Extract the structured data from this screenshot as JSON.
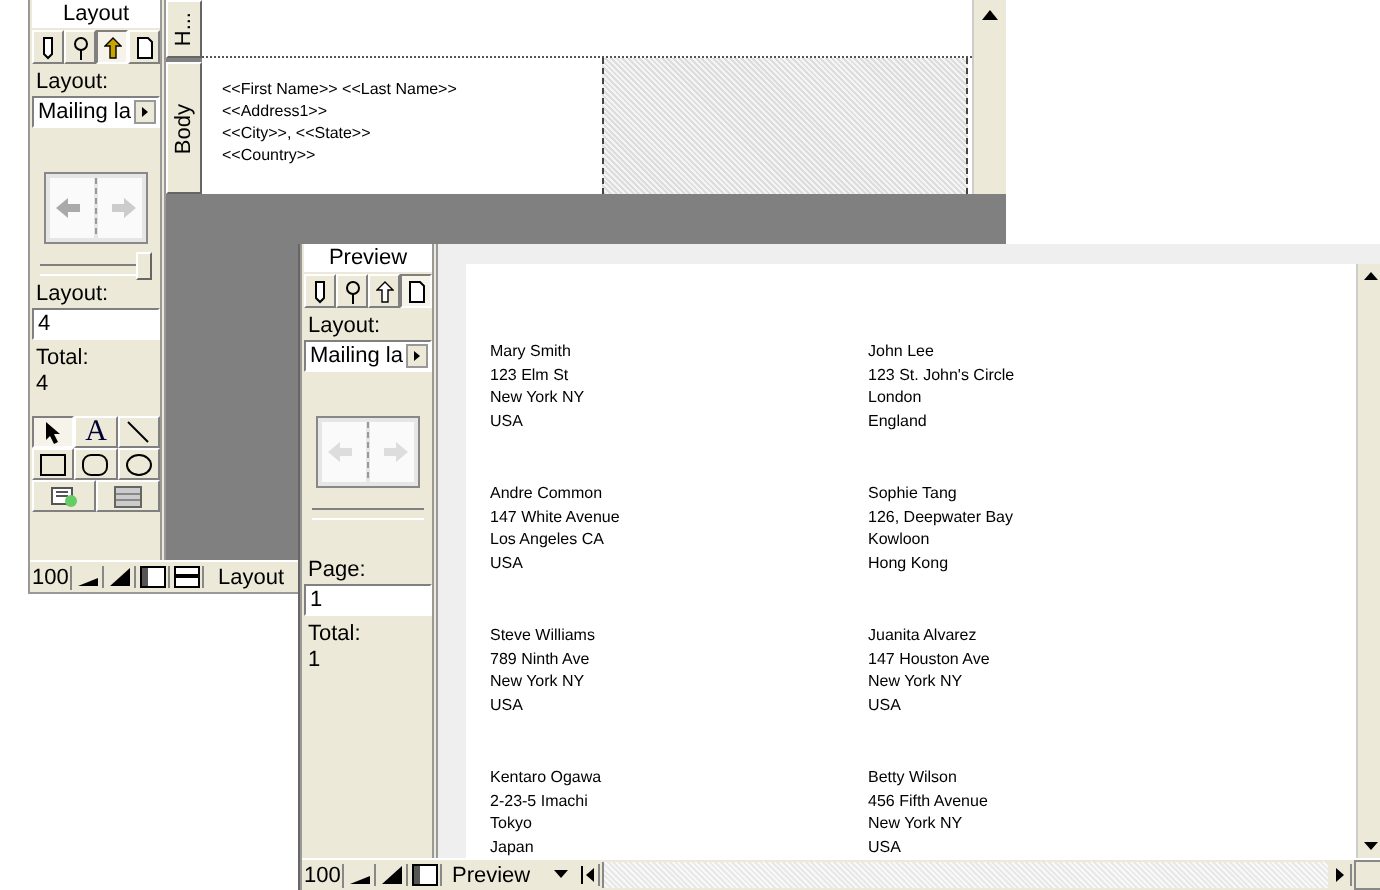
{
  "layout_window": {
    "mode_title": "Layout",
    "modes": [
      {
        "kind": "pencil",
        "selected": false
      },
      {
        "kind": "magnifier",
        "selected": false
      },
      {
        "kind": "arrow",
        "selected": true
      },
      {
        "kind": "page",
        "selected": false
      }
    ],
    "layout_label": "Layout:",
    "layout_menu": "Mailing la",
    "slider": {
      "level": 1
    },
    "record_label": "Layout:",
    "record_value": "4",
    "total_label": "Total:",
    "total_value": "4",
    "tools": [
      {
        "kind": "pointer",
        "selected": true
      },
      {
        "kind": "text",
        "label": "A",
        "selected": false
      },
      {
        "kind": "line",
        "selected": false
      },
      {
        "kind": "rect",
        "selected": false
      },
      {
        "kind": "roundrect",
        "selected": false
      },
      {
        "kind": "oval",
        "selected": false
      },
      {
        "kind": "portal",
        "selected": false
      },
      {
        "kind": "field",
        "selected": false
      }
    ],
    "parts": [
      {
        "label": "H..."
      },
      {
        "label": "Body"
      }
    ],
    "merge_fields": [
      "<<First Name>> <<Last Name>>",
      "<<Address1>>",
      "<<City>>, <<State>>",
      "<<Country>>"
    ],
    "status_bar": {
      "zoom": "100",
      "mode": "Layout"
    }
  },
  "preview_window": {
    "mode_title": "Preview",
    "modes": [
      {
        "kind": "pencil",
        "selected": false
      },
      {
        "kind": "magnifier",
        "selected": false
      },
      {
        "kind": "arrow",
        "selected": false
      },
      {
        "kind": "page",
        "selected": true
      }
    ],
    "layout_label": "Layout:",
    "layout_menu": "Mailing la",
    "page_label": "Page:",
    "page_value": "1",
    "total_label": "Total:",
    "total_value": "1",
    "labels": [
      [
        "Mary Smith",
        "123 Elm St",
        "New York NY",
        "USA"
      ],
      [
        "John Lee",
        "123 St. John's Circle",
        "London",
        "England"
      ],
      [
        "Andre Common",
        "147 White Avenue",
        "Los Angeles CA",
        "USA"
      ],
      [
        "Sophie Tang",
        "126, Deepwater Bay",
        "Kowloon",
        "Hong Kong"
      ],
      [
        "Steve Williams",
        "789 Ninth Ave",
        "New York NY",
        "USA"
      ],
      [
        "Juanita Alvarez",
        "147 Houston Ave",
        "New York NY",
        "USA"
      ],
      [
        "Kentaro Ogawa",
        "2-23-5 Imachi",
        "Tokyo",
        "Japan"
      ],
      [
        "Betty Wilson",
        "456 Fifth Avenue",
        "New York NY",
        "USA"
      ]
    ],
    "status_bar": {
      "zoom": "100",
      "mode": "Preview"
    }
  }
}
